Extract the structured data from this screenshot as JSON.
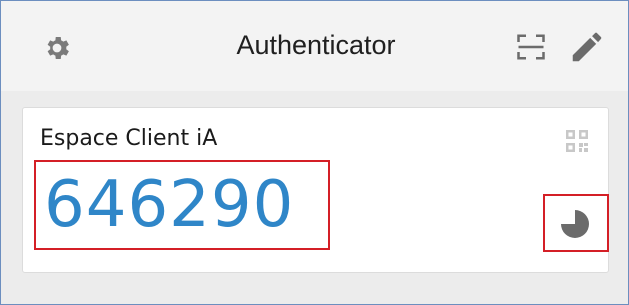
{
  "header": {
    "title": "Authenticator",
    "settings_icon": "gear-icon",
    "scan_icon": "scan-qr-icon",
    "edit_icon": "pencil-icon"
  },
  "account": {
    "name": "Espace Client iA",
    "code": "646290",
    "qr_icon": "qr-code-icon",
    "timer_icon": "countdown-pie-icon",
    "timer_remaining_fraction": 0.75
  },
  "colors": {
    "code": "#2f86c8",
    "highlight": "#d41f26",
    "frame_border": "#6c8ebf",
    "icon_gray": "#6b6b6b"
  }
}
